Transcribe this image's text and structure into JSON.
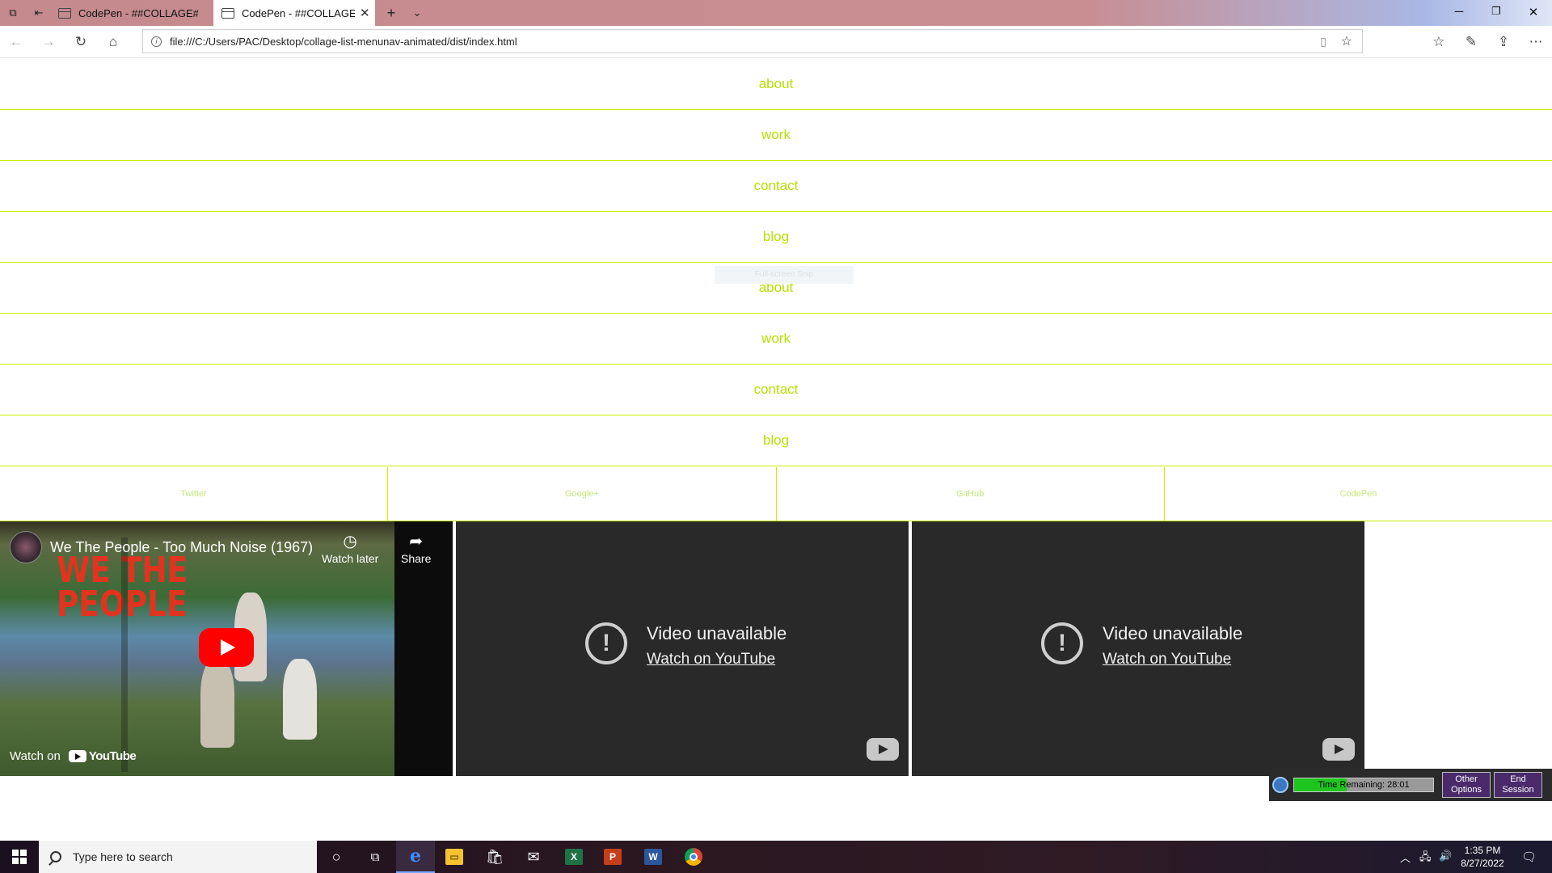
{
  "browser": {
    "tabs": [
      {
        "title": "CodePen - ##COLLAGE##LI",
        "active": false
      },
      {
        "title": "CodePen - ##COLLAGE##",
        "active": true
      }
    ],
    "url": "file:///C:/Users/PAC/Desktop/collage-list-menunav-animated/dist/index.html"
  },
  "page": {
    "nav_items": [
      "about",
      "work",
      "contact",
      "blog",
      "about",
      "work",
      "contact",
      "blog"
    ],
    "social": [
      "Twitter",
      "Google+",
      "GitHub",
      "CodePen"
    ],
    "snip_overlay": "Full-screen Snip",
    "accent_color": "#b6e000",
    "videos": [
      {
        "title": "We The People - Too Much Noise (1967)",
        "thumb_text": "WE THE PEOPLE",
        "watch_later": "Watch later",
        "share": "Share",
        "watch_on": "Watch on",
        "youtube": "YouTube"
      },
      {
        "message": "Video unavailable",
        "link": "Watch on YouTube"
      },
      {
        "message": "Video unavailable",
        "link": "Watch on YouTube"
      }
    ]
  },
  "session_timer": {
    "label": "Time Remaining: 28:01",
    "progress": 0.38,
    "other_options": "Other Options",
    "end_session": "End Session"
  },
  "taskbar": {
    "search_placeholder": "Type here to search",
    "time": "1:35 PM",
    "date": "8/27/2022",
    "pinned": [
      "cortana-icon",
      "task-view-icon",
      "edge-icon",
      "file-explorer-icon",
      "store-icon",
      "mail-icon",
      "excel-icon",
      "powerpoint-icon",
      "word-icon",
      "chrome-icon"
    ]
  }
}
